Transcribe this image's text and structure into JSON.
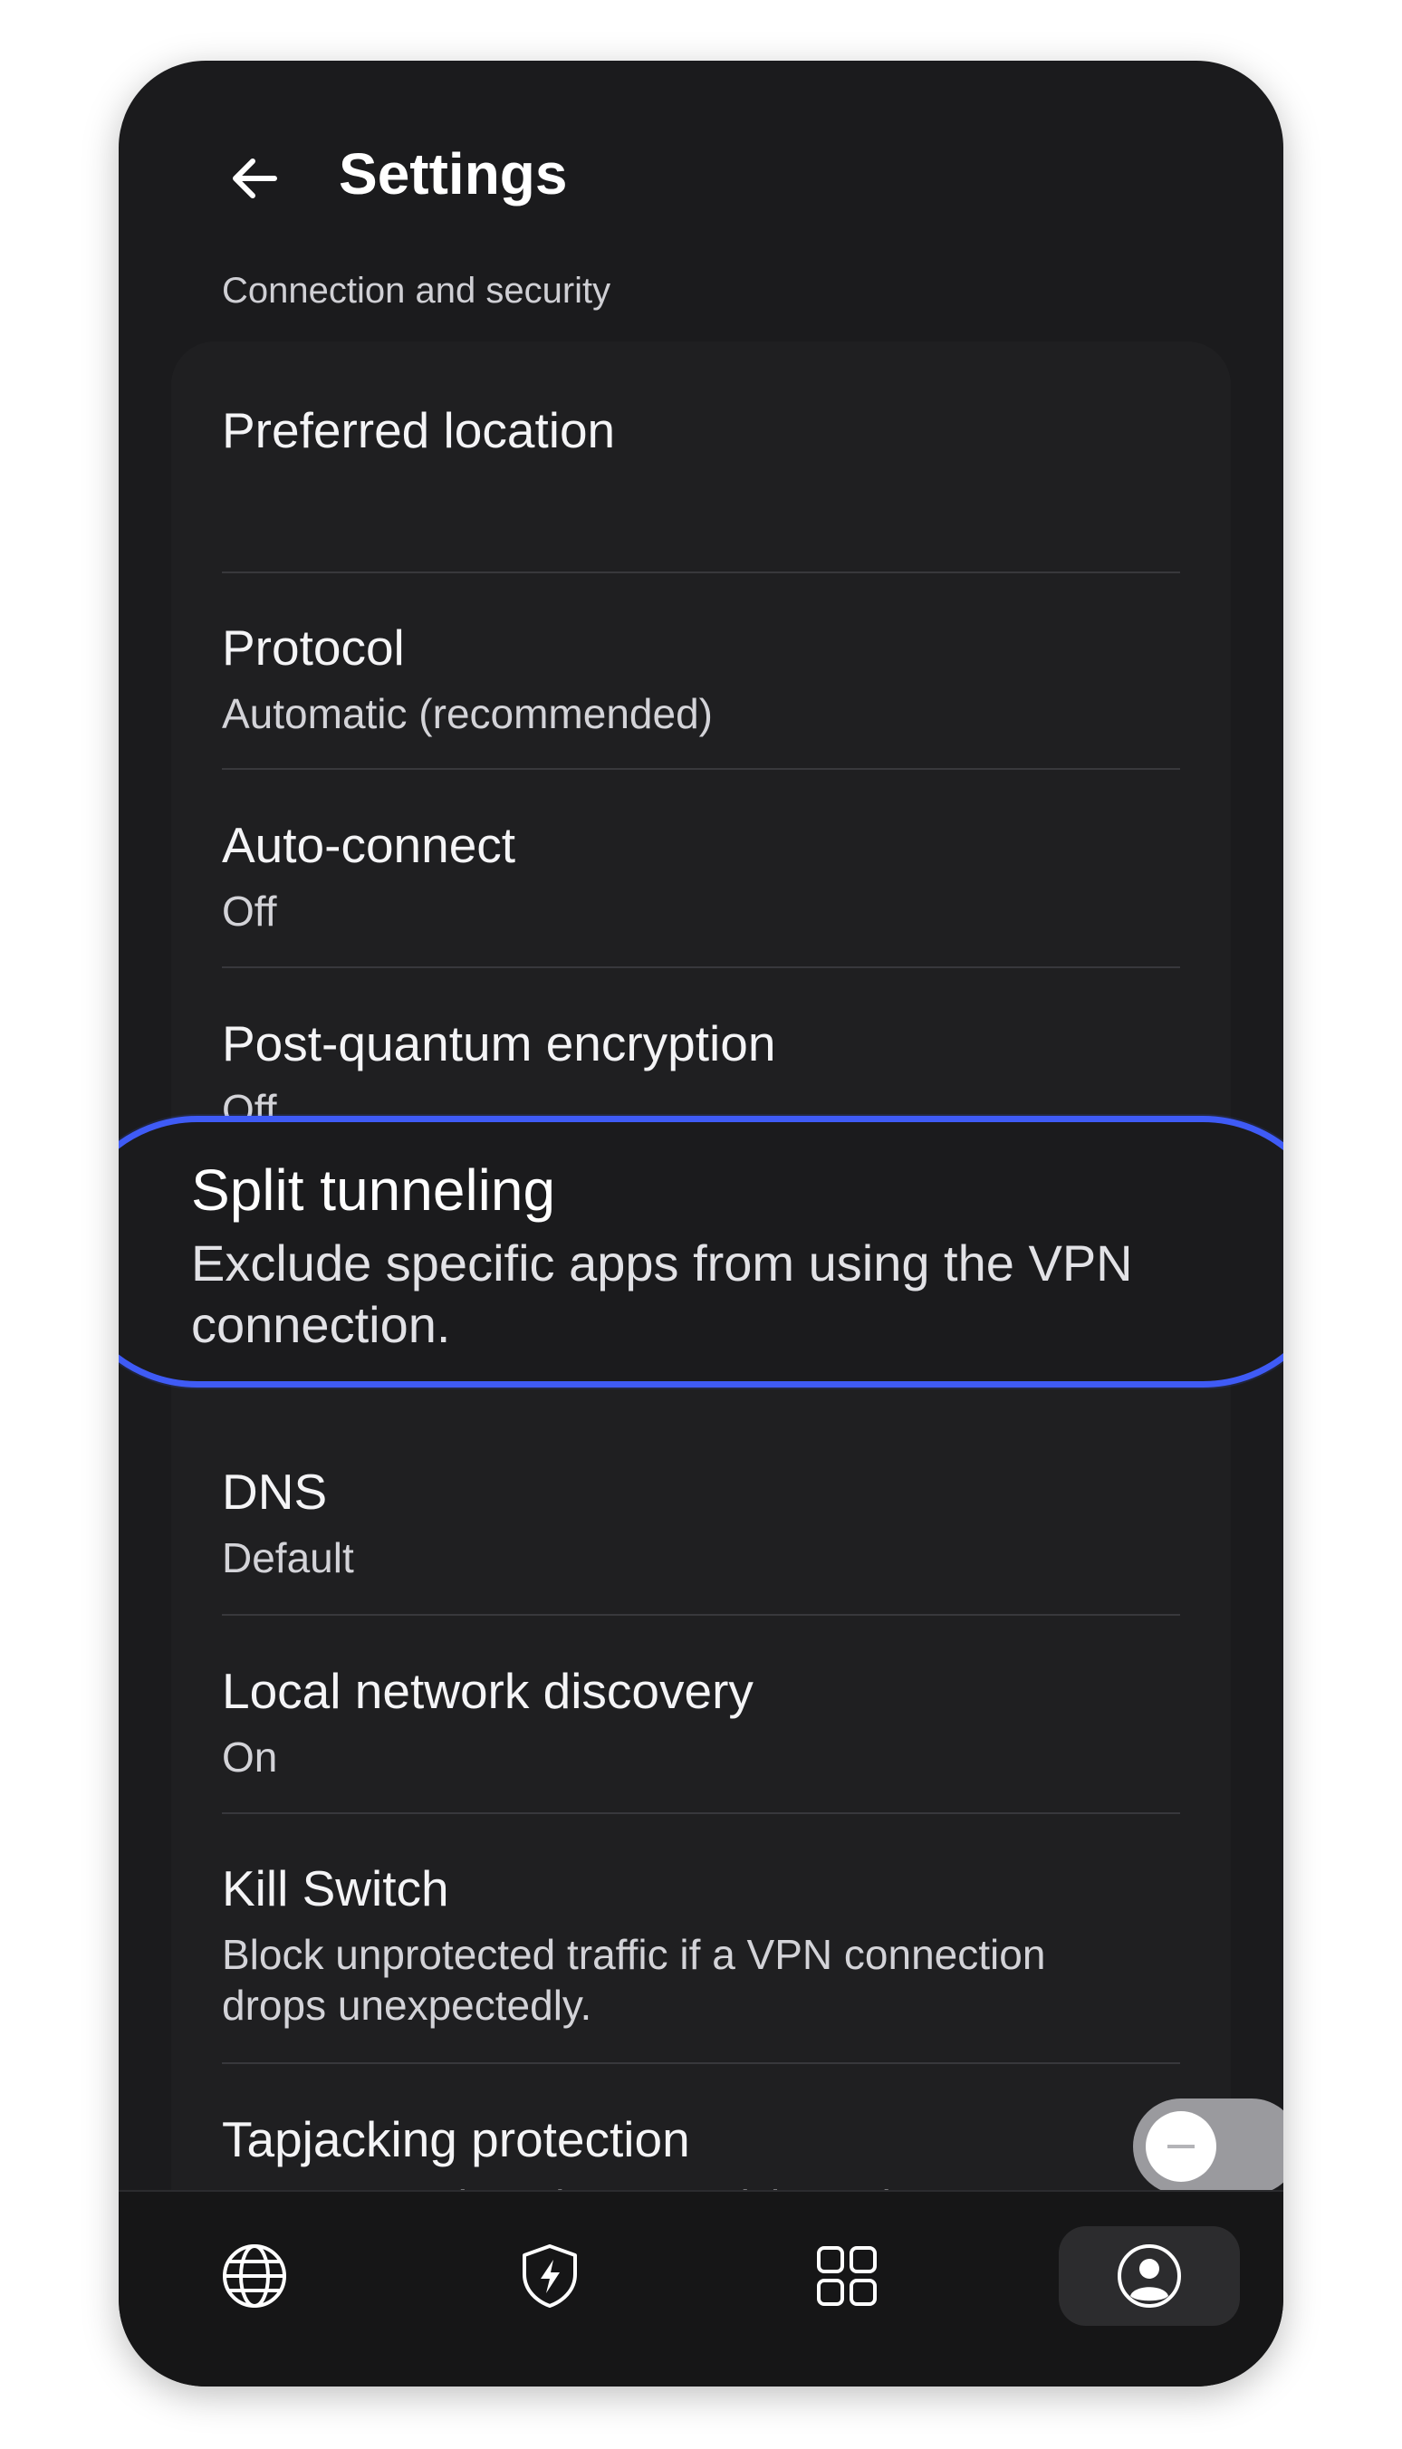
{
  "header": {
    "title": "Settings",
    "back_icon": "arrow-left-icon"
  },
  "section": {
    "label": "Connection and security"
  },
  "settings": {
    "preferred_location": {
      "title": "Preferred location"
    },
    "protocol": {
      "title": "Protocol",
      "value": "Automatic (recommended)"
    },
    "auto_connect": {
      "title": "Auto-connect",
      "value": "Off"
    },
    "post_quantum": {
      "title": "Post-quantum encryption",
      "value": "Off"
    },
    "split_tunneling": {
      "title": "Split tunneling",
      "description": "Exclude specific apps from using the VPN connection."
    },
    "dns": {
      "title": "DNS",
      "value": "Default"
    },
    "local_network": {
      "title": "Local network discovery",
      "value": "On"
    },
    "kill_switch": {
      "title": "Kill Switch",
      "description": "Block unprotected traffic if a VPN connection drops unexpectedly."
    },
    "tapjacking": {
      "title": "Tapjacking protection",
      "description": "Prevent overlays that may trick you into",
      "toggle_state": "off"
    }
  },
  "tabbar": {
    "tabs": [
      {
        "icon": "globe-icon",
        "active": false
      },
      {
        "icon": "shield-bolt-icon",
        "active": false
      },
      {
        "icon": "grid-icon",
        "active": false
      },
      {
        "icon": "profile-icon",
        "active": true
      }
    ]
  },
  "colors": {
    "background": "#1b1b1d",
    "highlight_border": "#3f5bf6",
    "toggle_off": "#9a9a9e"
  }
}
